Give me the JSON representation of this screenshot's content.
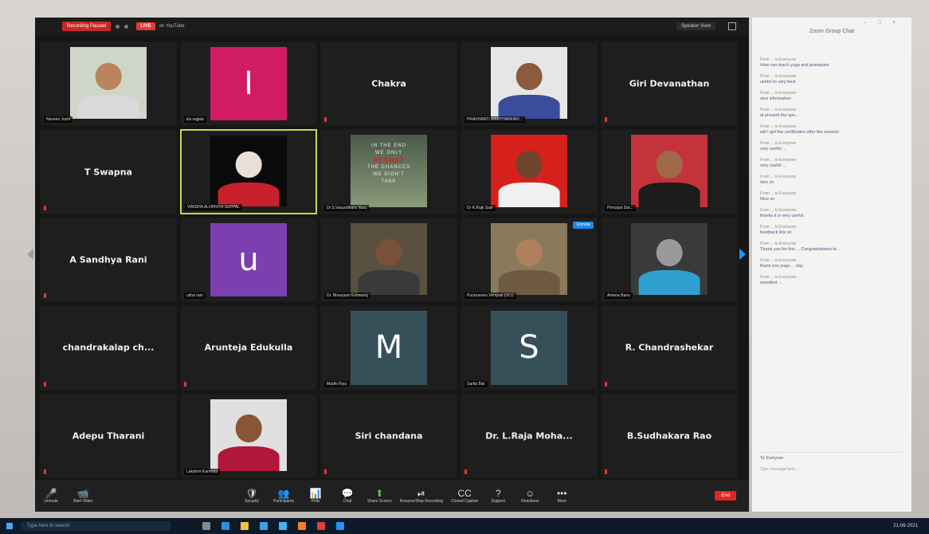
{
  "topbar": {
    "recording_label": "Recording Paused",
    "live_badge": "LIVE",
    "live_platform": "on YouTube",
    "speaker_view_label": "Speaker View"
  },
  "participants": [
    {
      "name": "Naveen Joshi",
      "kind": "photo",
      "skin": "#b9845e",
      "shirt": "#d9d9d9",
      "bg": "#cfd6c8"
    },
    {
      "name": "itsi sajjala",
      "kind": "letter",
      "letter": "I",
      "color": "#d11b62"
    },
    {
      "name": "Chakra",
      "kind": "name"
    },
    {
      "name": "PRASHANTI MARTHARKAVI...",
      "kind": "photo",
      "skin": "#8c5a3c",
      "shirt": "#3a4c9a",
      "bg": "#e6e6e6"
    },
    {
      "name": "Giri Devanathan",
      "kind": "name"
    },
    {
      "name": "T Swapna",
      "kind": "name"
    },
    {
      "name": "VINISHA ALOPRIYA SUPPAL",
      "kind": "photo",
      "skin": "#e8e0d8",
      "shirt": "#c8202a",
      "bg": "#0a0a0a",
      "active": true
    },
    {
      "name": "Dr.S.Vasundhara Vasu",
      "kind": "quote",
      "quote_lines": [
        "IN THE END",
        "WE ONLY",
        "REGRET",
        "THE CHANCES",
        "WE DIDN'T",
        "TAKE"
      ]
    },
    {
      "name": "Dr K.Rajk Sasi",
      "kind": "photo",
      "skin": "#6e442c",
      "shirt": "#f0f0f0",
      "bg": "#d6201c"
    },
    {
      "name": "Principal Dat...",
      "kind": "photo",
      "skin": "#a06a48",
      "shirt": "#1c1c1c",
      "bg": "#c4323c"
    },
    {
      "name": "A Sandhya Rani",
      "kind": "name"
    },
    {
      "name": "usha rani",
      "kind": "letter",
      "letter": "u",
      "color": "#7b3fb0"
    },
    {
      "name": "Dr. Bhavyasri Eshwaraj",
      "kind": "photo",
      "skin": "#7a5038",
      "shirt": "#3a3a3a",
      "bg": "#5a5040"
    },
    {
      "name": "Poornasree Vempati (OCC",
      "kind": "photo",
      "skin": "#b0805c",
      "shirt": "#6e5a40",
      "bg": "#8a7a5a",
      "chat_badge": "Unmute"
    },
    {
      "name": "Amena Banu",
      "kind": "photo",
      "skin": "#9a9a9a",
      "shirt": "#2f9fd0",
      "bg": "#3a3a3a"
    },
    {
      "name": "chandrakalap ch...",
      "kind": "name"
    },
    {
      "name": "Arunteja Edukulla",
      "kind": "name"
    },
    {
      "name": "Madhi Riya",
      "kind": "letter",
      "letter": "M",
      "color": "#36505a"
    },
    {
      "name": "Sarita Bisi",
      "kind": "letter",
      "letter": "S",
      "color": "#36505a"
    },
    {
      "name": "R. Chandrashekar",
      "kind": "name"
    },
    {
      "name": "Adepu Tharani",
      "kind": "name"
    },
    {
      "name": "Lakshmi Karmara",
      "kind": "photo",
      "skin": "#8a5436",
      "shirt": "#b0183a",
      "bg": "#e0e0e0"
    },
    {
      "name": "Siri chandana",
      "kind": "name"
    },
    {
      "name": "Dr. L.Raja Moha...",
      "kind": "name"
    },
    {
      "name": "B.Sudhakara Rao",
      "kind": "name"
    }
  ],
  "toolbar": {
    "items": [
      {
        "label": "Unmute",
        "icon": "🎤",
        "name": "unmute"
      },
      {
        "label": "Start Video",
        "icon": "📹",
        "name": "start-video"
      },
      {
        "label": "Security",
        "icon": "🛡",
        "name": "security"
      },
      {
        "label": "Participants",
        "icon": "👥",
        "name": "participants"
      },
      {
        "label": "Polls",
        "icon": "📊",
        "name": "polls"
      },
      {
        "label": "Chat",
        "icon": "💬",
        "name": "chat"
      },
      {
        "label": "Share Screen",
        "icon": "⬆",
        "name": "share-screen"
      },
      {
        "label": "Resume/Stop Recording",
        "icon": "⏯",
        "name": "recording"
      },
      {
        "label": "Closed Caption",
        "icon": "CC",
        "name": "closed-caption"
      },
      {
        "label": "Support",
        "icon": "?",
        "name": "support"
      },
      {
        "label": "Reactions",
        "icon": "☺",
        "name": "reactions"
      },
      {
        "label": "More",
        "icon": "•••",
        "name": "more"
      }
    ],
    "end_label": "End"
  },
  "chat": {
    "title": "Zoom Group Chat",
    "messages": [
      {
        "from": "From ... to Everyone",
        "text": "How can teach yoga and pranayam"
      },
      {
        "from": "From ... to Everyone",
        "text": "useful to very best"
      },
      {
        "from": "From ... to Everyone",
        "text": "nice information"
      },
      {
        "from": "From ... to Everyone",
        "text": "at present the spo..."
      },
      {
        "from": "From ... to Everyone",
        "text": "will I get the certificates after the session"
      },
      {
        "from": "From ... to Everyone",
        "text": "very useful ..."
      },
      {
        "from": "From ... to Everyone",
        "text": "very useful ..."
      },
      {
        "from": "From ... to Everyone",
        "text": "nice sir"
      },
      {
        "from": "From ... to Everyone",
        "text": "Nice sir"
      },
      {
        "from": "From ... to Everyone",
        "text": "thanks it is very useful"
      },
      {
        "from": "From ... to Everyone",
        "text": "feedback link sir"
      },
      {
        "from": "From ... to Everyone",
        "text": "Thank you for this ... Congratulations to ..."
      },
      {
        "from": "From ... to Everyone",
        "text": "thank you yoga ... day"
      },
      {
        "from": "From ... to Everyone",
        "text": "excellent ..."
      }
    ],
    "to_label": "To: Everyone",
    "input_placeholder": "Type message here..."
  },
  "taskbar": {
    "search_placeholder": "Type here to search",
    "clock": "21-06-2021"
  }
}
